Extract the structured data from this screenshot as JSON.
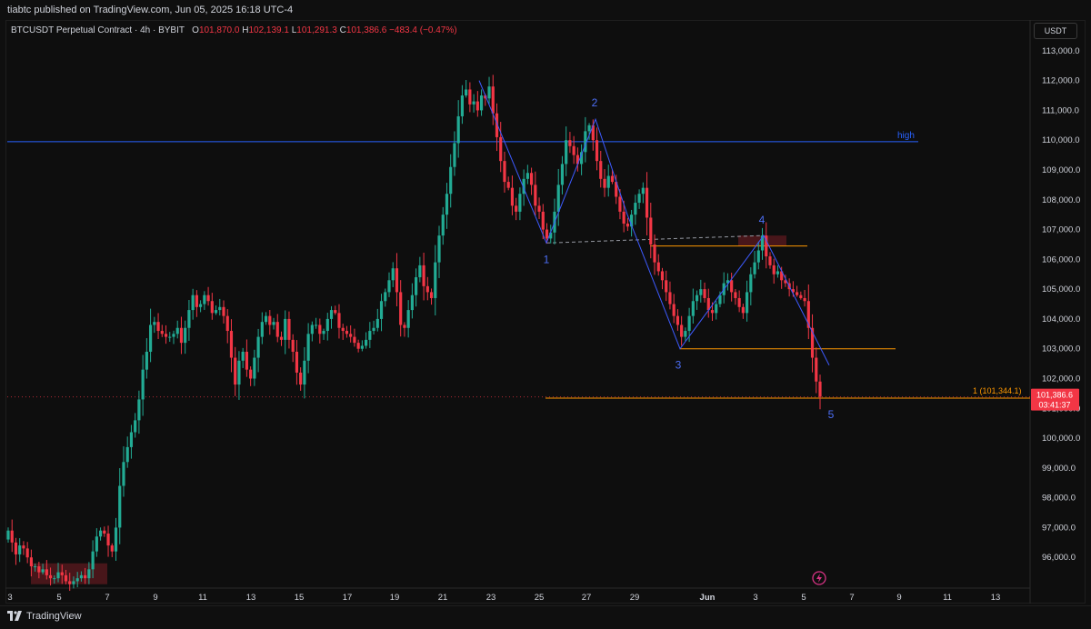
{
  "header": {
    "publish_line": "tiabtc published on TradingView.com, Jun 05, 2025 16:18 UTC-4"
  },
  "legend": {
    "symbol": "BTCUSDT Perpetual Contract · 4h · BYBIT",
    "open_label": "O",
    "open": "101,870.0",
    "high_label": "H",
    "high": "102,139.1",
    "low_label": "L",
    "low": "101,291.3",
    "close_label": "C",
    "close": "101,386.6",
    "change": "−483.4 (−0.47%)"
  },
  "price_scale": {
    "currency": "USDT",
    "labels": [
      "113,000.0",
      "112,000.0",
      "111,000.0",
      "110,000.0",
      "109,000.0",
      "108,000.0",
      "107,000.0",
      "106,000.0",
      "105,000.0",
      "104,000.0",
      "103,000.0",
      "102,000.0",
      "101,000.0",
      "100,000.0",
      "99,000.0",
      "98,000.0",
      "97,000.0",
      "96,000.0"
    ],
    "current_price": "101,386.6",
    "countdown": "03:41:37"
  },
  "time_scale": {
    "labels": [
      "3",
      "5",
      "7",
      "9",
      "11",
      "13",
      "15",
      "17",
      "19",
      "21",
      "23",
      "25",
      "27",
      "29",
      "Jun",
      "3",
      "5",
      "7",
      "9",
      "11",
      "13"
    ]
  },
  "annotations": {
    "high_label": "high",
    "fib_label": "1 (101,344.1)",
    "waves": [
      "1",
      "2",
      "3",
      "4",
      "5"
    ]
  },
  "footer": {
    "brand": "TradingView"
  },
  "colors": {
    "up": "#22ab94",
    "down": "#f23645",
    "wave_line": "#3d5afe",
    "orange": "#ff9800",
    "high_line": "#2962ff"
  },
  "chart_data": {
    "type": "candlestick",
    "title": "BTCUSDT Perpetual Contract · 4h · BYBIT",
    "ylim": [
      95000,
      113300
    ],
    "high_level": 109950,
    "fib_level": 101344.1,
    "orange_levels": [
      106450,
      103000
    ],
    "wave_points": [
      {
        "label": "1",
        "price": 106550
      },
      {
        "label": "2",
        "price": 110700
      },
      {
        "label": "3",
        "price": 103000
      },
      {
        "label": "4",
        "price": 106800
      },
      {
        "label": "5",
        "price": 101350
      }
    ],
    "closes": [
      96900,
      96500,
      96100,
      96400,
      96300,
      96000,
      95700,
      95700,
      95500,
      95600,
      95400,
      95300,
      95300,
      95500,
      95400,
      95200,
      95100,
      95200,
      95300,
      95400,
      95300,
      95600,
      96200,
      96700,
      96900,
      96800,
      96400,
      96200,
      97000,
      98400,
      99200,
      99700,
      100200,
      100600,
      101300,
      102300,
      102900,
      103800,
      103900,
      103600,
      103500,
      103400,
      103400,
      103500,
      103700,
      103200,
      103700,
      104300,
      104800,
      104400,
      104500,
      104800,
      104600,
      104200,
      104300,
      104400,
      104100,
      103600,
      102700,
      101800,
      102600,
      102900,
      102300,
      102000,
      102700,
      103400,
      103900,
      104100,
      103800,
      103900,
      103400,
      103300,
      104000,
      103300,
      102900,
      102200,
      101800,
      102600,
      103500,
      103800,
      103800,
      103500,
      103600,
      104000,
      104300,
      104200,
      103700,
      103600,
      103500,
      103400,
      103200,
      103000,
      103100,
      103300,
      103600,
      103700,
      104000,
      104600,
      104900,
      105300,
      105700,
      104900,
      103800,
      103700,
      104300,
      104800,
      105400,
      105800,
      105100,
      104900,
      104700,
      105900,
      106800,
      107500,
      108200,
      109100,
      109900,
      110800,
      111500,
      111700,
      111200,
      111300,
      111000,
      111500,
      111400,
      111800,
      110900,
      110100,
      109300,
      108600,
      108400,
      107800,
      107600,
      108200,
      108700,
      108900,
      108500,
      107800,
      107600,
      107000,
      106700,
      106900,
      107600,
      108500,
      109200,
      110000,
      109800,
      109500,
      109200,
      109600,
      110300,
      110500,
      110000,
      109300,
      108700,
      108400,
      108800,
      108600,
      108100,
      107600,
      107200,
      107100,
      107500,
      107900,
      108200,
      108400,
      107400,
      106500,
      105900,
      105600,
      105300,
      104900,
      104500,
      104100,
      103800,
      103400,
      103600,
      104100,
      104600,
      104800,
      105000,
      104700,
      104300,
      104200,
      104500,
      104800,
      105200,
      105300,
      104900,
      104700,
      104400,
      104200,
      104900,
      105500,
      105900,
      106300,
      106800,
      106100,
      105800,
      105500,
      105600,
      105300,
      105200,
      105000,
      104900,
      104800,
      104700,
      104600,
      103700,
      102700,
      101900,
      101387
    ]
  }
}
